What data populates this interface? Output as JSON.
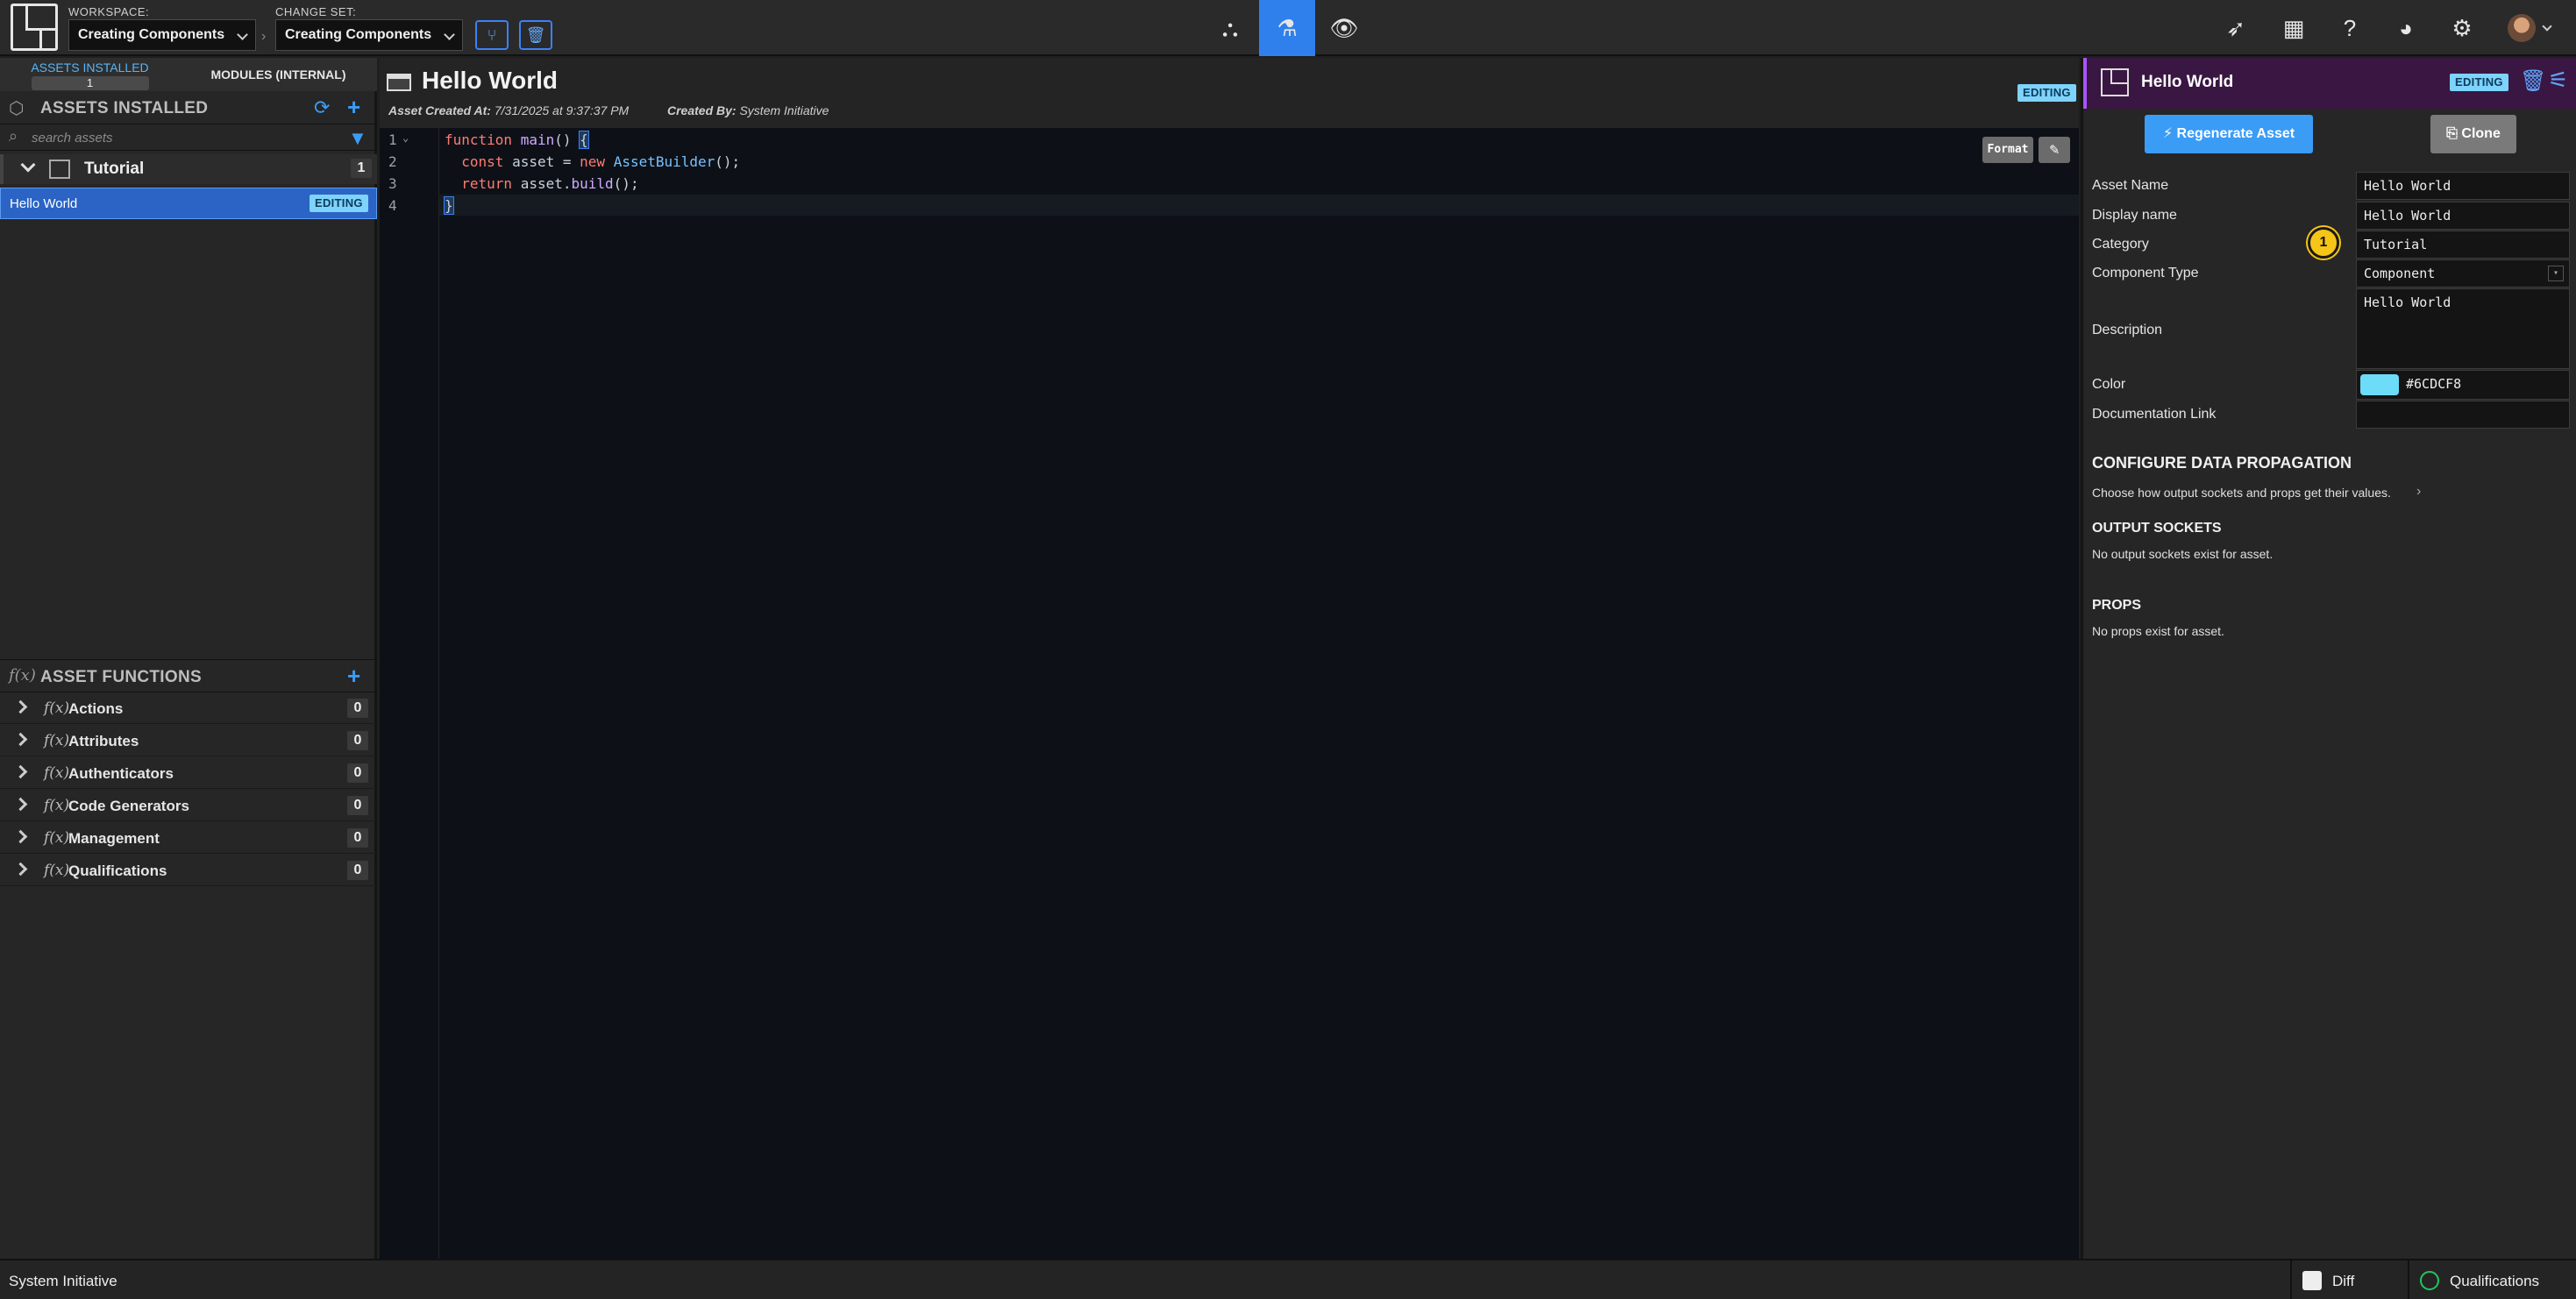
{
  "topbar": {
    "workspace_label": "WORKSPACE:",
    "workspace_value": "Creating Components",
    "changeset_label": "CHANGE SET:",
    "changeset_value": "Creating Components",
    "separator": "›"
  },
  "left": {
    "tab_assets": "ASSETS INSTALLED",
    "tab_assets_count": "1",
    "tab_modules": "MODULES (INTERNAL)",
    "section_title": "ASSETS INSTALLED",
    "search_placeholder": "search assets",
    "category": {
      "label": "Tutorial",
      "count": "1"
    },
    "asset": {
      "label": "Hello World",
      "badge": "EDITING"
    },
    "functions_title": "ASSET FUNCTIONS",
    "functions": [
      {
        "label": "Actions",
        "count": "0"
      },
      {
        "label": "Attributes",
        "count": "0"
      },
      {
        "label": "Authenticators",
        "count": "0"
      },
      {
        "label": "Code Generators",
        "count": "0"
      },
      {
        "label": "Management",
        "count": "0"
      },
      {
        "label": "Qualifications",
        "count": "0"
      }
    ]
  },
  "editor": {
    "title": "Hello World",
    "badge": "EDITING",
    "created_at_label": "Asset Created At:",
    "created_at_value": "7/31/2025 at 9:37:37 PM",
    "created_by_label": "Created By:",
    "created_by_value": "System Initiative",
    "format_label": "Format",
    "line_numbers": [
      "1",
      "2",
      "3",
      "4"
    ]
  },
  "right": {
    "title": "Hello World",
    "badge": "EDITING",
    "regenerate_label": "Regenerate Asset",
    "clone_label": "Clone",
    "fields": {
      "asset_name_label": "Asset Name",
      "asset_name_value": "Hello World",
      "display_name_label": "Display name",
      "display_name_value": "Hello World",
      "category_label": "Category",
      "category_value": "Tutorial",
      "component_type_label": "Component Type",
      "component_type_value": "Component",
      "description_label": "Description",
      "description_value": "Hello World",
      "color_label": "Color",
      "color_value": "#6CDCF8",
      "doc_link_label": "Documentation Link",
      "doc_link_value": ""
    },
    "marker": "1",
    "config_title": "CONFIGURE DATA PROPAGATION",
    "config_sub": "Choose how output sockets and props get their values.",
    "output_title": "OUTPUT SOCKETS",
    "output_sub": "No output sockets exist for asset.",
    "props_title": "PROPS",
    "props_sub": "No props exist for asset."
  },
  "status": {
    "app_name": "System Initiative",
    "diff_label": "Diff",
    "qualifications_label": "Qualifications"
  },
  "colors": {
    "accent": "#3b9cf6",
    "editing_badge": "#7dd3fc",
    "asset_color": "#6CDCF8",
    "marker": "#f5c518"
  }
}
